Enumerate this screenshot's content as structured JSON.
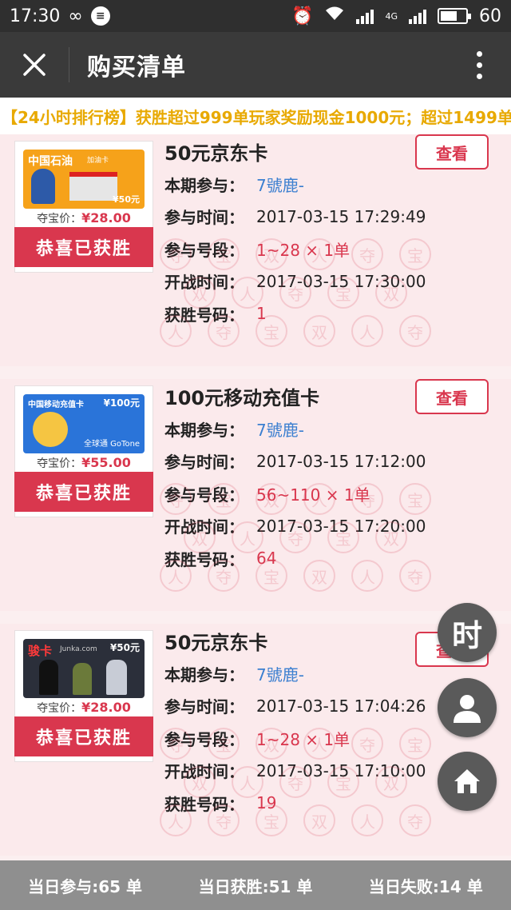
{
  "status_bar": {
    "time": "17:30",
    "network": "4G",
    "battery": "60"
  },
  "header": {
    "title": "购买清单",
    "close_icon": "close-icon",
    "more_icon": "more-vertical-icon"
  },
  "marquee": {
    "text": "【24小时排行榜】获胜超过999单玩家奖励现金1000元；超过1499单玩"
  },
  "labels": {
    "participant": "本期参与：",
    "join_time": "参与时间：",
    "number_range": "参与号段：",
    "start_time": "开战时间：",
    "win_number": "获胜号码：",
    "treasure_price": "夺宝价：",
    "won_badge": "恭喜已获胜",
    "view_button": "查看"
  },
  "orders": [
    {
      "title": "50元京东卡",
      "card_brand": "中国石油",
      "card_subtitle": "加油卡",
      "card_value": "¥50元",
      "price": "¥28.00",
      "participant": "7號鹿-",
      "join_time": "2017-03-15 17:29:49",
      "number_range": "1~28 × 1单",
      "start_time": "2017-03-15 17:30:00",
      "win_number": "1"
    },
    {
      "title": "100元移动充值卡",
      "card_brand": "中国移动充值卡",
      "card_subtitle": "全球通 GoTone",
      "card_value": "¥100元",
      "price": "¥55.00",
      "participant": "7號鹿-",
      "join_time": "2017-03-15 17:12:00",
      "number_range": "56~110 × 1单",
      "start_time": "2017-03-15 17:20:00",
      "win_number": "64"
    },
    {
      "title": "50元京东卡",
      "card_brand": "骏卡",
      "card_subtitle": "Junka.com",
      "card_value": "¥50元",
      "price": "¥28.00",
      "participant": "7號鹿-",
      "join_time": "2017-03-15 17:04:26",
      "number_range": "1~28 × 1单",
      "start_time": "2017-03-15 17:10:00",
      "win_number": "19"
    }
  ],
  "watermark_chars": [
    "夺",
    "宝",
    "双",
    "人"
  ],
  "floating": {
    "time_label": "时",
    "user_icon": "user-icon",
    "home_icon": "home-icon"
  },
  "footer": {
    "participated": "当日参与:65 单",
    "won": "当日获胜:51 单",
    "lost": "当日失败:14 单"
  },
  "colors": {
    "accent": "#d9374e",
    "participant_blue": "#3b7fd0",
    "marquee_yellow": "#e8a900",
    "header_bg": "#3a3a3a",
    "footer_bg": "#8f8f8f"
  }
}
